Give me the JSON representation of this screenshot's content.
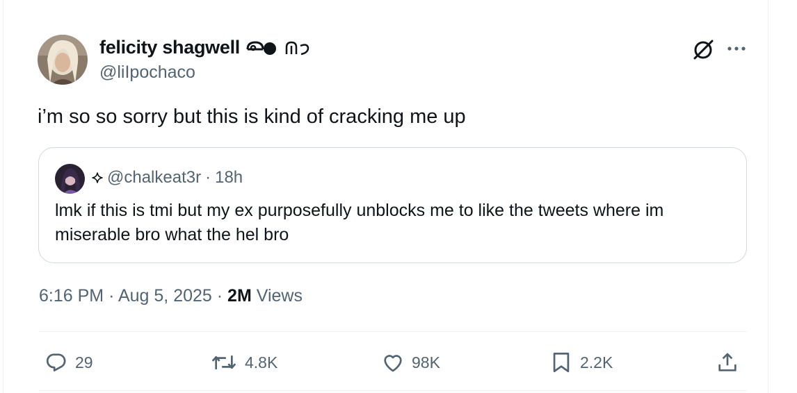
{
  "author": {
    "display_name": "felicity shagwell",
    "handle": "@liIpochaco"
  },
  "tweet": {
    "text": "i’m so so sorry but this is kind of cracking me up",
    "time": "6:16 PM",
    "date": "Aug 5, 2025",
    "views_count": "2M",
    "views_label": "Views"
  },
  "quoted": {
    "handle": "@chalkeat3r",
    "age": "18h",
    "text": "lmk if this is tmi but my ex purposefully unblocks me to like the tweets where im miserable bro what the hel bro"
  },
  "actions": {
    "replies": "29",
    "reposts": "4.8K",
    "likes": "98K",
    "bookmarks": "2.2K"
  },
  "icons": [
    "grok-icon",
    "more-icon",
    "reply-icon",
    "repost-icon",
    "like-icon",
    "bookmark-icon",
    "share-icon",
    "sparkle-icon"
  ],
  "colors": {
    "text": "#0f1419",
    "secondary": "#536471",
    "border": "#cfd9de"
  }
}
